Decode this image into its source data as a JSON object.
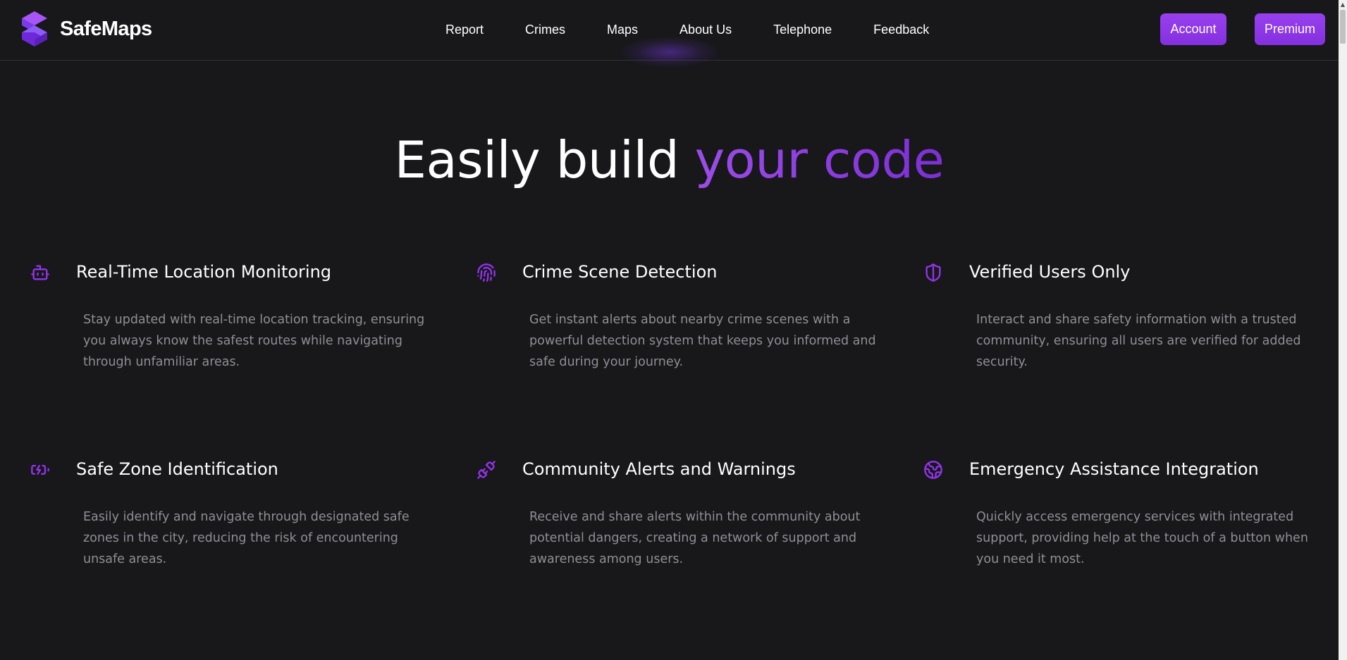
{
  "brand": {
    "name": "SafeMaps"
  },
  "nav": {
    "items": [
      {
        "label": "Report"
      },
      {
        "label": "Crimes"
      },
      {
        "label": "Maps"
      },
      {
        "label": "About Us"
      },
      {
        "label": "Telephone"
      },
      {
        "label": "Feedback"
      }
    ]
  },
  "header_buttons": {
    "account": "Account",
    "premium": "Premium"
  },
  "hero": {
    "title_white": "Easily build ",
    "title_accent": "your code"
  },
  "colors": {
    "background": "#18181b",
    "accent": "#8b3fe0",
    "button": "#8b33e6",
    "body_text": "#8e8e96"
  },
  "features": [
    {
      "icon": "robot-icon",
      "title": "Real-Time Location Monitoring",
      "desc": "Stay updated with real-time location tracking, ensuring you always know the safest routes while navigating through unfamiliar areas."
    },
    {
      "icon": "fingerprint-icon",
      "title": "Crime Scene Detection",
      "desc": "Get instant alerts about nearby crime scenes with a powerful detection system that keeps you informed and safe during your journey."
    },
    {
      "icon": "shield-icon",
      "title": "Verified Users Only",
      "desc": "Interact and share safety information with a trusted community, ensuring all users are verified for added security."
    },
    {
      "icon": "battery-charging-icon",
      "title": "Safe Zone Identification",
      "desc": "Easily identify and navigate through designated safe zones in the city, reducing the risk of encountering unsafe areas."
    },
    {
      "icon": "plug-icon",
      "title": "Community Alerts and Warnings",
      "desc": "Receive and share alerts within the community about potential dangers, creating a network of support and awareness among users."
    },
    {
      "icon": "globe-icon",
      "title": "Emergency Assistance Integration",
      "desc": "Quickly access emergency services with integrated support, providing help at the touch of a button when you need it most."
    }
  ]
}
